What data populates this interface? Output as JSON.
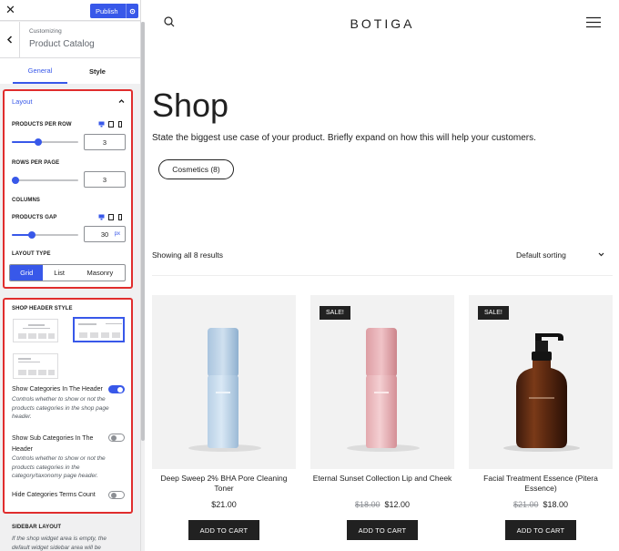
{
  "customizer": {
    "publish_label": "Publish",
    "customizing_label": "Customizing",
    "section_title": "Product Catalog",
    "tabs": [
      {
        "label": "General",
        "active": true
      },
      {
        "label": "Style",
        "active": false
      }
    ],
    "layout": {
      "heading": "Layout",
      "products_per_row": {
        "label": "PRODUCTS PER ROW",
        "value": "3",
        "slider_fraction": 0.4
      },
      "rows_per_page": {
        "label": "ROWS PER PAGE",
        "value": "3",
        "slider_fraction": 0.05
      },
      "columns_label": "COLUMNS",
      "products_gap": {
        "label": "PRODUCTS GAP",
        "value": "30",
        "unit": "px",
        "slider_fraction": 0.3
      },
      "layout_type": {
        "label": "LAYOUT TYPE",
        "options": [
          "Grid",
          "List",
          "Masonry"
        ],
        "selected": "Grid"
      }
    },
    "shop_header": {
      "heading": "SHOP HEADER STYLE",
      "show_categories": {
        "label": "Show Categories In The Header",
        "desc": "Controls whether to show or not the products categories in the shop page header.",
        "on": true
      },
      "show_sub_categories": {
        "label": "Show Sub Categories In The Header",
        "desc": "Controls whether to show or not the products categories in the category/taxonomy page header.",
        "on": false
      },
      "hide_terms_count": {
        "label": "Hide Categories Terms Count",
        "on": false
      }
    },
    "sidebar_layout": {
      "heading": "SIDEBAR LAYOUT",
      "desc": "If the shop widget area is empty, the default widget sidebar area will be"
    },
    "colors": {
      "accent": "#3858e9",
      "highlight": "#e02d2d"
    }
  },
  "preview": {
    "brand": "BOTIGA",
    "title": "Shop",
    "description": "State the biggest use case of your product. Briefly expand on how this will help your customers.",
    "category_pill": "Cosmetics (8)",
    "results_text": "Showing all 8 results",
    "sorting": "Default sorting",
    "products": [
      {
        "name": "Deep Sweep 2% BHA Pore Cleaning Toner",
        "price": "$21.00",
        "old_price": "",
        "sale_badge": "",
        "button": "ADD TO CART"
      },
      {
        "name": "Eternal Sunset Collection Lip and Cheek",
        "price": "$12.00",
        "old_price": "$18.00",
        "sale_badge": "SALE!",
        "button": "ADD TO CART"
      },
      {
        "name": "Facial Treatment Essence (Pitera Essence)",
        "price": "$18.00",
        "old_price": "$21.00",
        "sale_badge": "SALE!",
        "button": "ADD TO CART"
      }
    ]
  }
}
